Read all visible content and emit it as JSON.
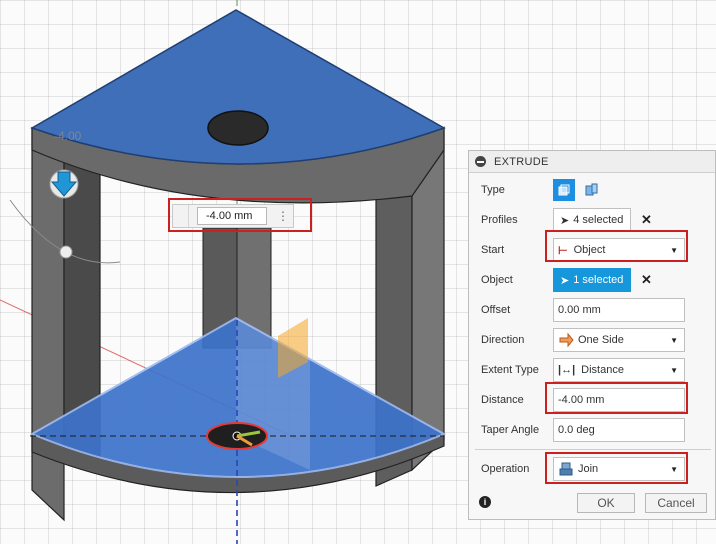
{
  "viewport": {
    "inline_distance_value": "-4.00 mm",
    "ghost_value": "-4.00"
  },
  "panel": {
    "title": "EXTRUDE",
    "rows": {
      "type": {
        "label": "Type"
      },
      "profiles": {
        "label": "Profiles",
        "value": "4 selected"
      },
      "start": {
        "label": "Start",
        "value": "Object"
      },
      "object": {
        "label": "Object",
        "value": "1 selected"
      },
      "offset": {
        "label": "Offset",
        "value": "0.00 mm"
      },
      "direction": {
        "label": "Direction",
        "value": "One Side"
      },
      "extent_type": {
        "label": "Extent Type",
        "value": "Distance"
      },
      "distance": {
        "label": "Distance",
        "value": "-4.00 mm"
      },
      "taper_angle": {
        "label": "Taper Angle",
        "value": "0.0 deg"
      },
      "operation": {
        "label": "Operation",
        "value": "Join"
      }
    },
    "buttons": {
      "ok": "OK",
      "cancel": "Cancel"
    }
  },
  "colors": {
    "accent_blue": "#1e8ee0",
    "highlight_red": "#cc1f1f",
    "top_face_blue": "#3f6fb8"
  }
}
